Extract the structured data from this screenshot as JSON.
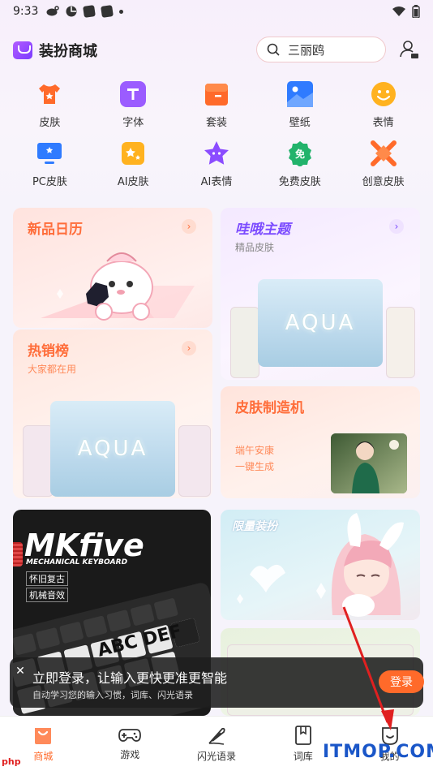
{
  "status": {
    "time": "9:33"
  },
  "header": {
    "title": "装扮商城",
    "search_value": "三丽鸥"
  },
  "categories": [
    {
      "label": "皮肤",
      "color": "#ff6a2a"
    },
    {
      "label": "字体",
      "color": "#9b5cff"
    },
    {
      "label": "套装",
      "color": "#ff6a2a"
    },
    {
      "label": "壁纸",
      "color": "#2f7bff"
    },
    {
      "label": "表情",
      "color": "#ffb21f"
    },
    {
      "label": "PC皮肤",
      "color": "#2f7bff"
    },
    {
      "label": "AI皮肤",
      "color": "#ffb21f"
    },
    {
      "label": "AI表情",
      "color": "#8b4cff"
    },
    {
      "label": "免费皮肤",
      "color": "#22b36b"
    },
    {
      "label": "创意皮肤",
      "color": "#ff6a2a"
    }
  ],
  "cards": {
    "new_calendar": {
      "title": "新品日历"
    },
    "wahoo": {
      "title": "哇哦主题",
      "subtitle": "精品皮肤",
      "aqua": "AQUA"
    },
    "hot": {
      "title": "热销榜",
      "subtitle": "大家都在用",
      "aqua": "AQUA"
    },
    "maker": {
      "title": "皮肤制造机",
      "line1": "端午安康",
      "line2": "一键生成"
    },
    "mkfive": {
      "title": "MKfive",
      "subtitle": "MECHANICAL KEYBOARD",
      "tag1": "怀旧复古",
      "tag2": "机械音效",
      "keys": [
        "ABC",
        "DEF"
      ]
    },
    "limited": {
      "title": "限量装扮"
    }
  },
  "toast": {
    "title": "立即登录，让输入更快更准更智能",
    "subtitle": "自动学习您的输入习惯，词库、闪光语录",
    "button": "登录"
  },
  "bottom_nav": [
    {
      "label": "商城",
      "active": true
    },
    {
      "label": "游戏",
      "active": false
    },
    {
      "label": "闪光语录",
      "active": false
    },
    {
      "label": "词库",
      "active": false
    },
    {
      "label": "我的",
      "active": false
    }
  ],
  "watermark": "ITMOP.COM",
  "watermark_small": "php"
}
